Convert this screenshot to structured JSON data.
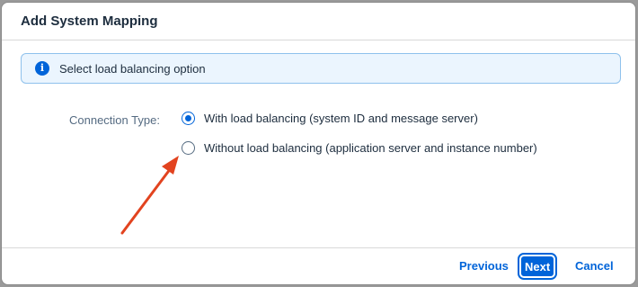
{
  "dialog": {
    "title": "Add System Mapping"
  },
  "info": {
    "icon": "info-icon",
    "glyph": "i",
    "text": "Select load balancing option",
    "accent": "#0064d9"
  },
  "form": {
    "connection_type_label": "Connection Type:",
    "options": [
      {
        "label": "With load balancing (system ID and message server)",
        "selected": true
      },
      {
        "label": "Without load balancing (application server and instance number)",
        "selected": false
      }
    ]
  },
  "annotation": {
    "icon": "red-arrow-icon",
    "color": "#e2431f"
  },
  "footer": {
    "previous_label": "Previous",
    "next_label": "Next",
    "cancel_label": "Cancel"
  }
}
